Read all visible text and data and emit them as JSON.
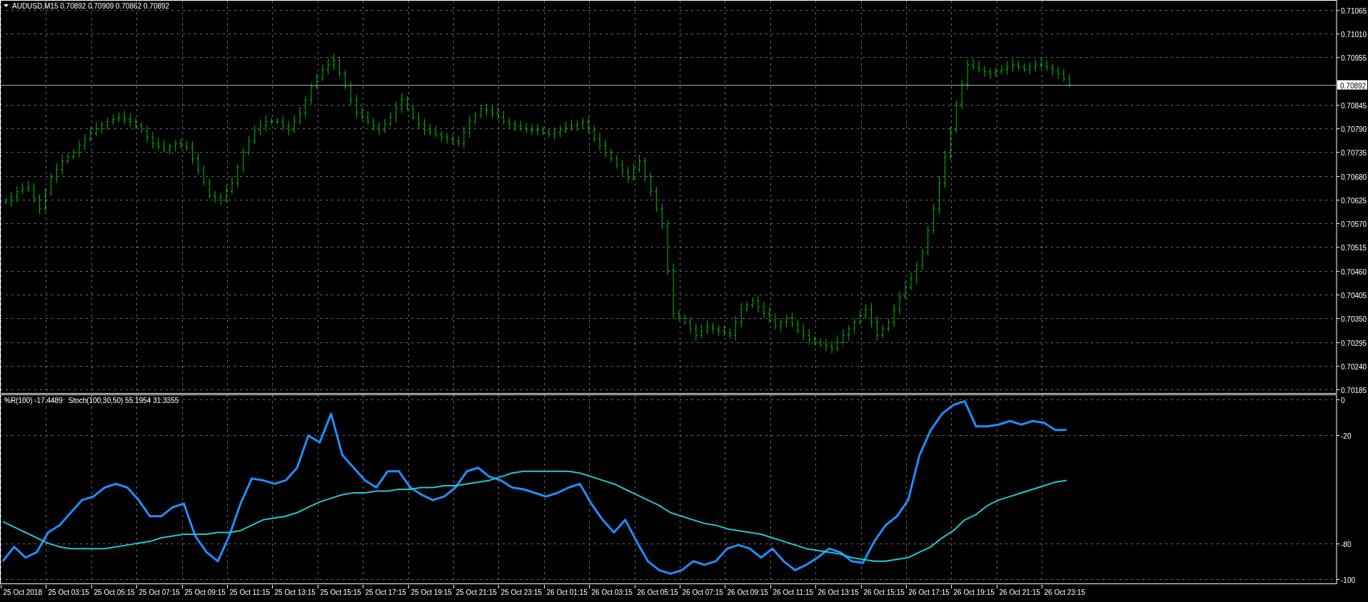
{
  "header": {
    "symbol_line": "AUDUSD,M15 0.70892 0.70909 0.70862 0.70892"
  },
  "price_axis": {
    "labels": [
      "0.71065",
      "0.71010",
      "0.70955",
      "0.70845",
      "0.70790",
      "0.70735",
      "0.70680",
      "0.70625",
      "0.70570",
      "0.70515",
      "0.70460",
      "0.70405",
      "0.70350",
      "0.70295",
      "0.70240",
      "0.70185"
    ],
    "current_price": "0.70892"
  },
  "indicator": {
    "legend_values": [
      "-17.4489",
      "55.1954 31.3355"
    ],
    "chart_data": {
      "type": "line",
      "grid": true,
      "ylim": [
        -100,
        0
      ],
      "yticks": [
        {
          "value": 0,
          "label": "0"
        },
        {
          "value": -20,
          "label": "-20"
        },
        {
          "value": -80,
          "label": "-80"
        },
        {
          "value": -100,
          "label": "-100"
        }
      ],
      "series": [
        {
          "name": "%R(100)",
          "color": "#1e90ff",
          "values": [
            -90,
            -82,
            -88,
            -85,
            -74,
            -70,
            -63,
            -56,
            -54,
            -49,
            -47,
            -49,
            -56,
            -65,
            -65,
            -60,
            -58,
            -76,
            -85,
            -90,
            -76,
            -58,
            -44,
            -45,
            -47,
            -45,
            -38,
            -20,
            -24,
            -8,
            -31,
            -38,
            -45,
            -49,
            -40,
            -40,
            -49,
            -53,
            -56,
            -54,
            -49,
            -40,
            -38,
            -43,
            -45,
            -49,
            -50,
            -52,
            -54,
            -52,
            -49,
            -47,
            -58,
            -67,
            -74,
            -67,
            -79,
            -90,
            -95,
            -97,
            -95,
            -90,
            -92,
            -90,
            -83,
            -81,
            -83,
            -88,
            -83,
            -90,
            -95,
            -92,
            -88,
            -83,
            -85,
            -90,
            -91,
            -79,
            -70,
            -65,
            -56,
            -31,
            -17,
            -8,
            -3,
            -1,
            -15,
            -15,
            -14,
            -12,
            -14,
            -12,
            -13,
            -17,
            -17
          ]
        },
        {
          "name": "Stoch(100,30,50)",
          "color": "#20c8d0",
          "values": [
            -68,
            -71,
            -74,
            -77,
            -80,
            -82,
            -83,
            -83,
            -83,
            -83,
            -82,
            -81,
            -80,
            -79,
            -77,
            -76,
            -75,
            -75,
            -75,
            -74,
            -74,
            -73,
            -70,
            -67,
            -66,
            -65,
            -63,
            -60,
            -57,
            -55,
            -53,
            -52,
            -52,
            -51,
            -51,
            -50,
            -50,
            -49,
            -49,
            -48,
            -48,
            -47,
            -46,
            -45,
            -43,
            -41,
            -40,
            -40,
            -40,
            -40,
            -40,
            -41,
            -43,
            -45,
            -47,
            -50,
            -53,
            -56,
            -59,
            -63,
            -65,
            -67,
            -69,
            -70,
            -72,
            -73,
            -74,
            -75,
            -77,
            -79,
            -81,
            -83,
            -84,
            -85,
            -86,
            -88,
            -89,
            -90,
            -90,
            -89,
            -88,
            -85,
            -82,
            -77,
            -73,
            -67,
            -64,
            -59,
            -56,
            -54,
            -52,
            -50,
            -48,
            -46,
            -45
          ]
        }
      ]
    }
  },
  "time_axis": [
    "25 Oct 2018",
    "25 Oct 03:15",
    "25 Oct 05:15",
    "25 Oct 07:15",
    "25 Oct 09:15",
    "25 Oct 11:15",
    "25 Oct 13:15",
    "25 Oct 15:15",
    "25 Oct 17:15",
    "25 Oct 19:15",
    "25 Oct 21:15",
    "25 Oct 23:15",
    "26 Oct 01:15",
    "26 Oct 03:15",
    "26 Oct 05:15",
    "26 Oct 07:15",
    "26 Oct 09:15",
    "26 Oct 11:15",
    "26 Oct 13:15",
    "26 Oct 15:15",
    "26 Oct 17:15",
    "26 Oct 19:15",
    "26 Oct 21:15",
    "26 Oct 23:15"
  ]
}
